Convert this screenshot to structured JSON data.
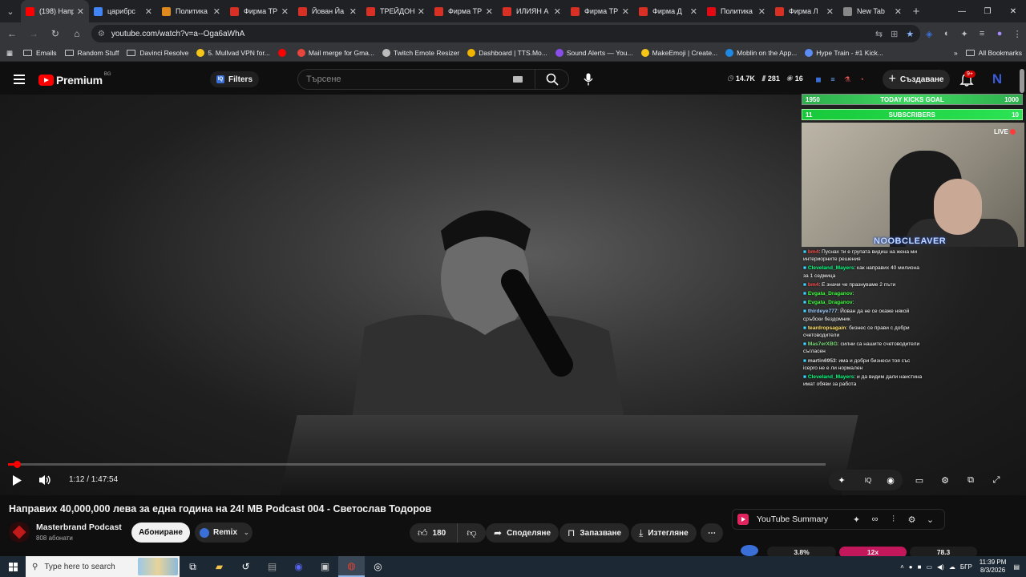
{
  "browser": {
    "tabs": [
      {
        "label": "(198) Напр",
        "icon": "youtube-icon",
        "color": "#ff0000",
        "active": true
      },
      {
        "label": "царибрс",
        "icon": "google-icon",
        "color": "#4285f4"
      },
      {
        "label": "Политика",
        "icon": "site-icon",
        "color": "#e08a1e"
      },
      {
        "label": "Фирма ТР",
        "icon": "p-icon",
        "color": "#d93025"
      },
      {
        "label": "Йован Йа",
        "icon": "p-icon",
        "color": "#d93025"
      },
      {
        "label": "ТРЕЙДОН",
        "icon": "p-icon",
        "color": "#d93025"
      },
      {
        "label": "Фирма ТР",
        "icon": "p-icon",
        "color": "#d93025"
      },
      {
        "label": "ИЛИЯН А",
        "icon": "p-icon",
        "color": "#d93025"
      },
      {
        "label": "Фирма ТР",
        "icon": "p-icon",
        "color": "#d93025"
      },
      {
        "label": "Фирма Д",
        "icon": "p-icon",
        "color": "#d93025"
      },
      {
        "label": "Политика",
        "icon": "n-icon",
        "color": "#e50914"
      },
      {
        "label": "Фирма Л",
        "icon": "p-icon",
        "color": "#d93025"
      },
      {
        "label": "New Tab",
        "icon": "chrome-icon",
        "color": "#888888"
      }
    ],
    "url": "youtube.com/watch?v=a--Oga6aWhA",
    "bookmarks": [
      {
        "label": "Emails",
        "icon": "folder"
      },
      {
        "label": "Random Stuff",
        "icon": "folder"
      },
      {
        "label": "Davinci Resolve",
        "icon": "folder"
      },
      {
        "label": "5. Mullvad VPN for...",
        "icon": "mullvad",
        "color": "#f5c518"
      },
      {
        "label": "",
        "icon": "youtube",
        "color": "#ff0000"
      },
      {
        "label": "Mail merge for Gma...",
        "icon": "mail",
        "color": "#e8453c"
      },
      {
        "label": "Twitch Emote Resizer",
        "icon": "twitch",
        "color": "#bbbbbb"
      },
      {
        "label": "Dashboard | TTS.Mo...",
        "icon": "tts",
        "color": "#f0b400"
      },
      {
        "label": "Sound Alerts — You...",
        "icon": "sound",
        "color": "#8a4de8"
      },
      {
        "label": "MakeEmoji | Create...",
        "icon": "emoji",
        "color": "#f5c518"
      },
      {
        "label": "Moblin on the App...",
        "icon": "appstore",
        "color": "#1e88e5"
      },
      {
        "label": "Hype Train - #1 Kick...",
        "icon": "shield",
        "color": "#5c8df6"
      }
    ],
    "all_bookmarks": "All Bookmarks"
  },
  "yt": {
    "logo_word": "Premium",
    "country": "BG",
    "filters": "Filters",
    "search_placeholder": "Търсене",
    "stats": {
      "views": "14.7K",
      "likes": "281",
      "viewers": "16"
    },
    "create": "Създаване",
    "bell_badge": "9+",
    "avatar": "N"
  },
  "player": {
    "time": "1:12 / 1:47:54",
    "progress_fraction": 0.011
  },
  "overlay": {
    "goal1": {
      "left": "1950",
      "mid": "TODAY KICKS GOAL",
      "right": "1000"
    },
    "goal2": {
      "left": "11",
      "mid": "SUBSCRIBERS",
      "right": "10"
    },
    "live": "LIVE",
    "streamer": "NOOBCLEAVER",
    "chat": [
      {
        "user": "bm4",
        "text": ": Пуснах ти е групата видиш на жена ми интериорните решения",
        "color": "#ff4d4d"
      },
      {
        "user": "Cleveland_Mayers",
        "text": ": как направих 40 милиона за 1 седмица",
        "color": "#00ff7f"
      },
      {
        "user": "bm4",
        "text": ": Е значи че празнуваме 2 пъти",
        "color": "#ff4d4d"
      },
      {
        "user": "Evgata_Draganov",
        "text": ":",
        "color": "#3cff3c"
      },
      {
        "user": "Evgata_Draganov",
        "text": ":",
        "color": "#3cff3c"
      },
      {
        "user": "thirdeye777",
        "text": ": Йован да не се окаже някой сръбски бездомник",
        "color": "#9ecbff"
      },
      {
        "user": "teardropsagain",
        "text": ": бизнес се прави с добри счетоводители",
        "color": "#ffe066"
      },
      {
        "user": "Mas7erXBG",
        "text": ": силни са нашите счетоводители съгласен",
        "color": "#7ddf7d"
      },
      {
        "user": "martin6953",
        "text": ": има и добри бизнеси тоя със icepro не е ли нормален",
        "color": "#dddddd"
      },
      {
        "user": "Cleveland_Mayers",
        "text": ": и да видим дали наистина имат обяви за работа",
        "color": "#00ff7f"
      }
    ]
  },
  "video": {
    "title": "Направих 40,000,000 лева за една година на 24! MB Podcast 004 - Светослав Тодоров",
    "channel": "Masterbrand Podcast",
    "subs": "808 абонати",
    "subscribe": "Абониране",
    "remix": "Remix",
    "likes": "180",
    "share": "Споделяне",
    "save": "Запазване",
    "download": "Изтегляне"
  },
  "summary": {
    "label": "YouTube Summary",
    "stat1": "3.8%",
    "stat2": "12x",
    "stat3": "78.3"
  },
  "taskbar": {
    "search_placeholder": "Type here to search",
    "lang": "БГР",
    "time": "11:39 PM",
    "date": "8/3/2026"
  }
}
